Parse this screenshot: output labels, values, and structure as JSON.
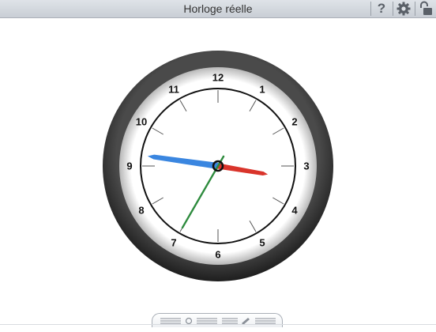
{
  "window": {
    "title": "Horloge réelle"
  },
  "toolbar": {
    "help_icon": "question-mark-icon",
    "settings_icon": "gear-icon",
    "lock_icon": "unlocked-padlock-icon"
  },
  "clock": {
    "numbers": [
      "12",
      "1",
      "2",
      "3",
      "4",
      "5",
      "6",
      "7",
      "8",
      "9",
      "10",
      "11"
    ],
    "time": {
      "hour": 9,
      "minute": 16,
      "second": 35
    },
    "colors": {
      "hour_hand": "#3a86e0",
      "minute_hand": "#d9342b",
      "second_hand": "#2e8b3e",
      "bezel": "#3a3a3a",
      "face": "#ffffff"
    }
  },
  "tray": {
    "tabs": [
      {
        "id": "clock-mode",
        "icon": "clock-icon"
      },
      {
        "id": "edit-mode",
        "icon": "pencil-icon"
      }
    ]
  }
}
